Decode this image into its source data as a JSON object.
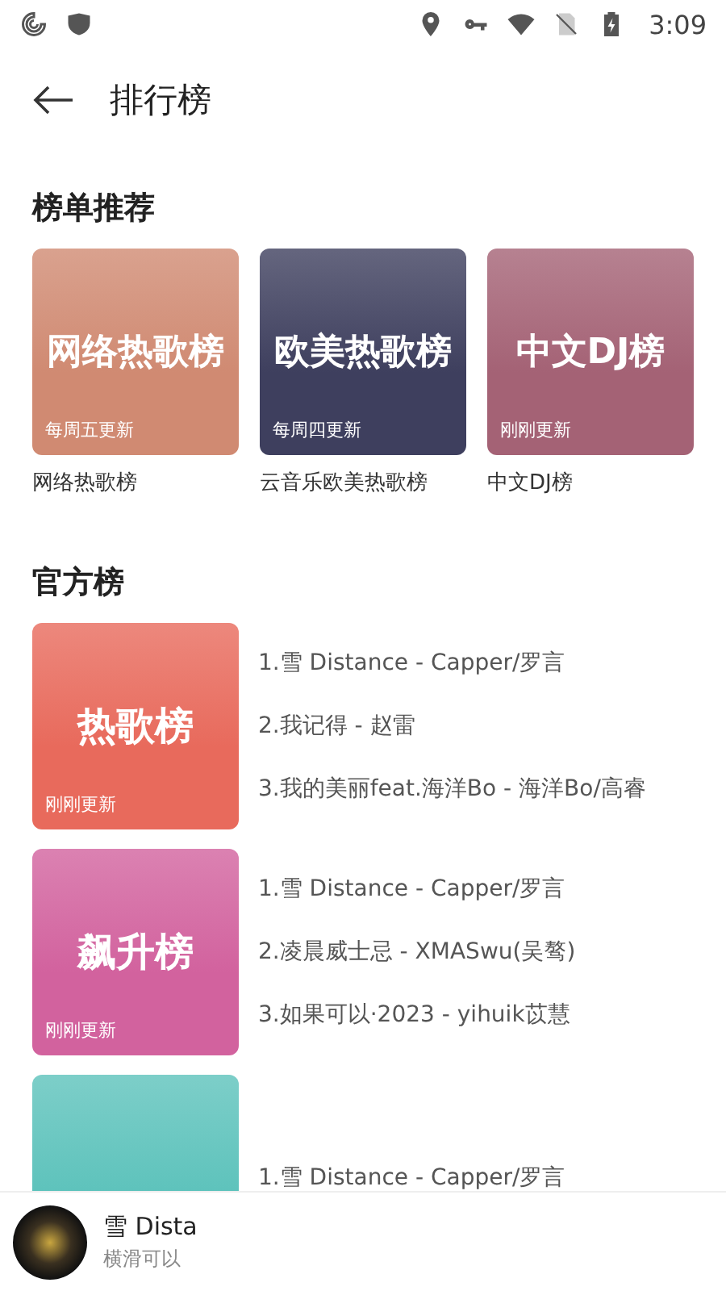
{
  "status_bar": {
    "time": "3:09"
  },
  "header": {
    "title": "排行榜"
  },
  "recommended": {
    "title": "榜单推荐",
    "items": [
      {
        "cover_title": "网络热歌榜",
        "update": "每周五更新",
        "caption": "网络热歌榜",
        "color": "#d08a72"
      },
      {
        "cover_title": "欧美热歌榜",
        "update": "每周四更新",
        "caption": "云音乐欧美热歌榜",
        "color": "#3e3f5e"
      },
      {
        "cover_title": "中文DJ榜",
        "update": "刚刚更新",
        "caption": "中文DJ榜",
        "color": "#a46275"
      }
    ]
  },
  "official": {
    "title": "官方榜",
    "charts": [
      {
        "cover_title": "热歌榜",
        "update": "刚刚更新",
        "color": "#e86a5c",
        "tracks": [
          "1.雪 Distance - Capper/罗言",
          "2.我记得 - 赵雷",
          "3.我的美丽feat.海洋Bo - 海洋Bo/高睿"
        ]
      },
      {
        "cover_title": "飙升榜",
        "update": "刚刚更新",
        "color": "#d2629e",
        "tracks": [
          "1.雪 Distance - Capper/罗言",
          "2.凌晨威士忌 - XMASwu(吴骜)",
          "3.如果可以·2023 - yihuik苡慧"
        ]
      },
      {
        "color": "#5cc2bb",
        "tracks": [
          "1.雪 Distance - Capper/罗言"
        ]
      }
    ]
  },
  "player": {
    "title": "雪 Dista",
    "subtitle": "横滑可以"
  }
}
